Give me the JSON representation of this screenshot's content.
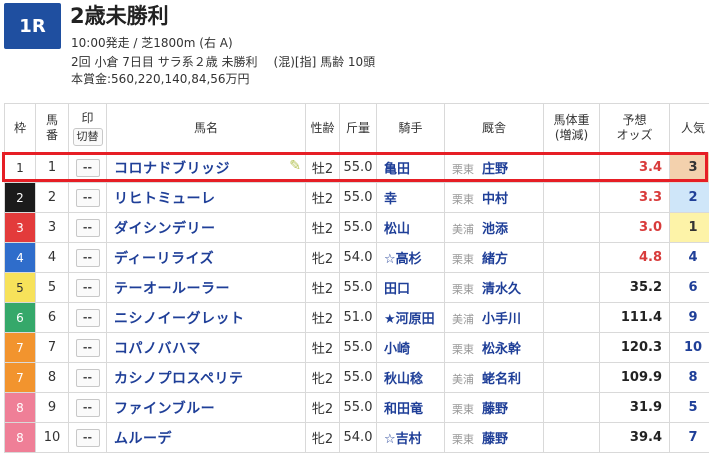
{
  "race": {
    "number": "1R",
    "title": "2歳未勝利",
    "line1": "10:00発走 / 芝1800m (右 A)",
    "line2": "2回 小倉 7日目 サラ系２歳 未勝利",
    "line2_extra": "(混)[指] 馬齢 10頭",
    "line3": "本賞金:560,220,140,84,56万円"
  },
  "columns": {
    "waku": "枠",
    "umaban": "馬\n番",
    "mark": "印",
    "mark_toggle": "切替",
    "name": "馬名",
    "sex_age": "性齢",
    "kg": "斤量",
    "jockey": "騎手",
    "stable": "厩舎",
    "weight": "馬体重\n(増減)",
    "odds": "予想\nオッズ",
    "pop": "人気"
  },
  "mark_placeholder": "--",
  "highlight_color": "#e61e25",
  "rows": [
    {
      "waku": "1",
      "umaban": "1",
      "name": "コロナドブリッジ",
      "has_icon": true,
      "sex_age": "牡2",
      "kg": "55.0",
      "jockey": "亀田",
      "area": "栗東",
      "trainer": "庄野",
      "odds": "3.4",
      "pop": "3"
    },
    {
      "waku": "2",
      "umaban": "2",
      "name": "リヒトミューレ",
      "sex_age": "牡2",
      "kg": "55.0",
      "jockey": "幸",
      "area": "栗東",
      "trainer": "中村",
      "odds": "3.3",
      "pop": "2"
    },
    {
      "waku": "3",
      "umaban": "3",
      "name": "ダイシンデリー",
      "sex_age": "牡2",
      "kg": "55.0",
      "jockey": "松山",
      "area": "美浦",
      "trainer": "池添",
      "odds": "3.0",
      "pop": "1"
    },
    {
      "waku": "4",
      "umaban": "4",
      "name": "ディーリライズ",
      "sex_age": "牝2",
      "kg": "54.0",
      "jockey": "☆高杉",
      "area": "栗東",
      "trainer": "緒方",
      "odds": "4.8",
      "pop": "4"
    },
    {
      "waku": "5",
      "umaban": "5",
      "name": "テーオールーラー",
      "sex_age": "牡2",
      "kg": "55.0",
      "jockey": "田口",
      "area": "栗東",
      "trainer": "清水久",
      "odds": "35.2",
      "pop": "6"
    },
    {
      "waku": "6",
      "umaban": "6",
      "name": "ニシノイーグレット",
      "sex_age": "牡2",
      "kg": "51.0",
      "jockey": "★河原田",
      "area": "美浦",
      "trainer": "小手川",
      "odds": "111.4",
      "pop": "9"
    },
    {
      "waku": "7",
      "umaban": "7",
      "name": "コパノバハマ",
      "sex_age": "牡2",
      "kg": "55.0",
      "jockey": "小崎",
      "area": "栗東",
      "trainer": "松永幹",
      "odds": "120.3",
      "pop": "10"
    },
    {
      "waku": "7",
      "umaban": "8",
      "name": "カシノプロスペリテ",
      "sex_age": "牝2",
      "kg": "55.0",
      "jockey": "秋山稔",
      "area": "美浦",
      "trainer": "蛯名利",
      "odds": "109.9",
      "pop": "8"
    },
    {
      "waku": "8",
      "umaban": "9",
      "name": "ファインブルー",
      "sex_age": "牝2",
      "kg": "55.0",
      "jockey": "和田竜",
      "area": "栗東",
      "trainer": "藤野",
      "odds": "31.9",
      "pop": "5"
    },
    {
      "waku": "8",
      "umaban": "10",
      "name": "ムルーデ",
      "sex_age": "牝2",
      "kg": "54.0",
      "jockey": "☆吉村",
      "area": "栗東",
      "trainer": "藤野",
      "odds": "39.4",
      "pop": "7"
    }
  ]
}
